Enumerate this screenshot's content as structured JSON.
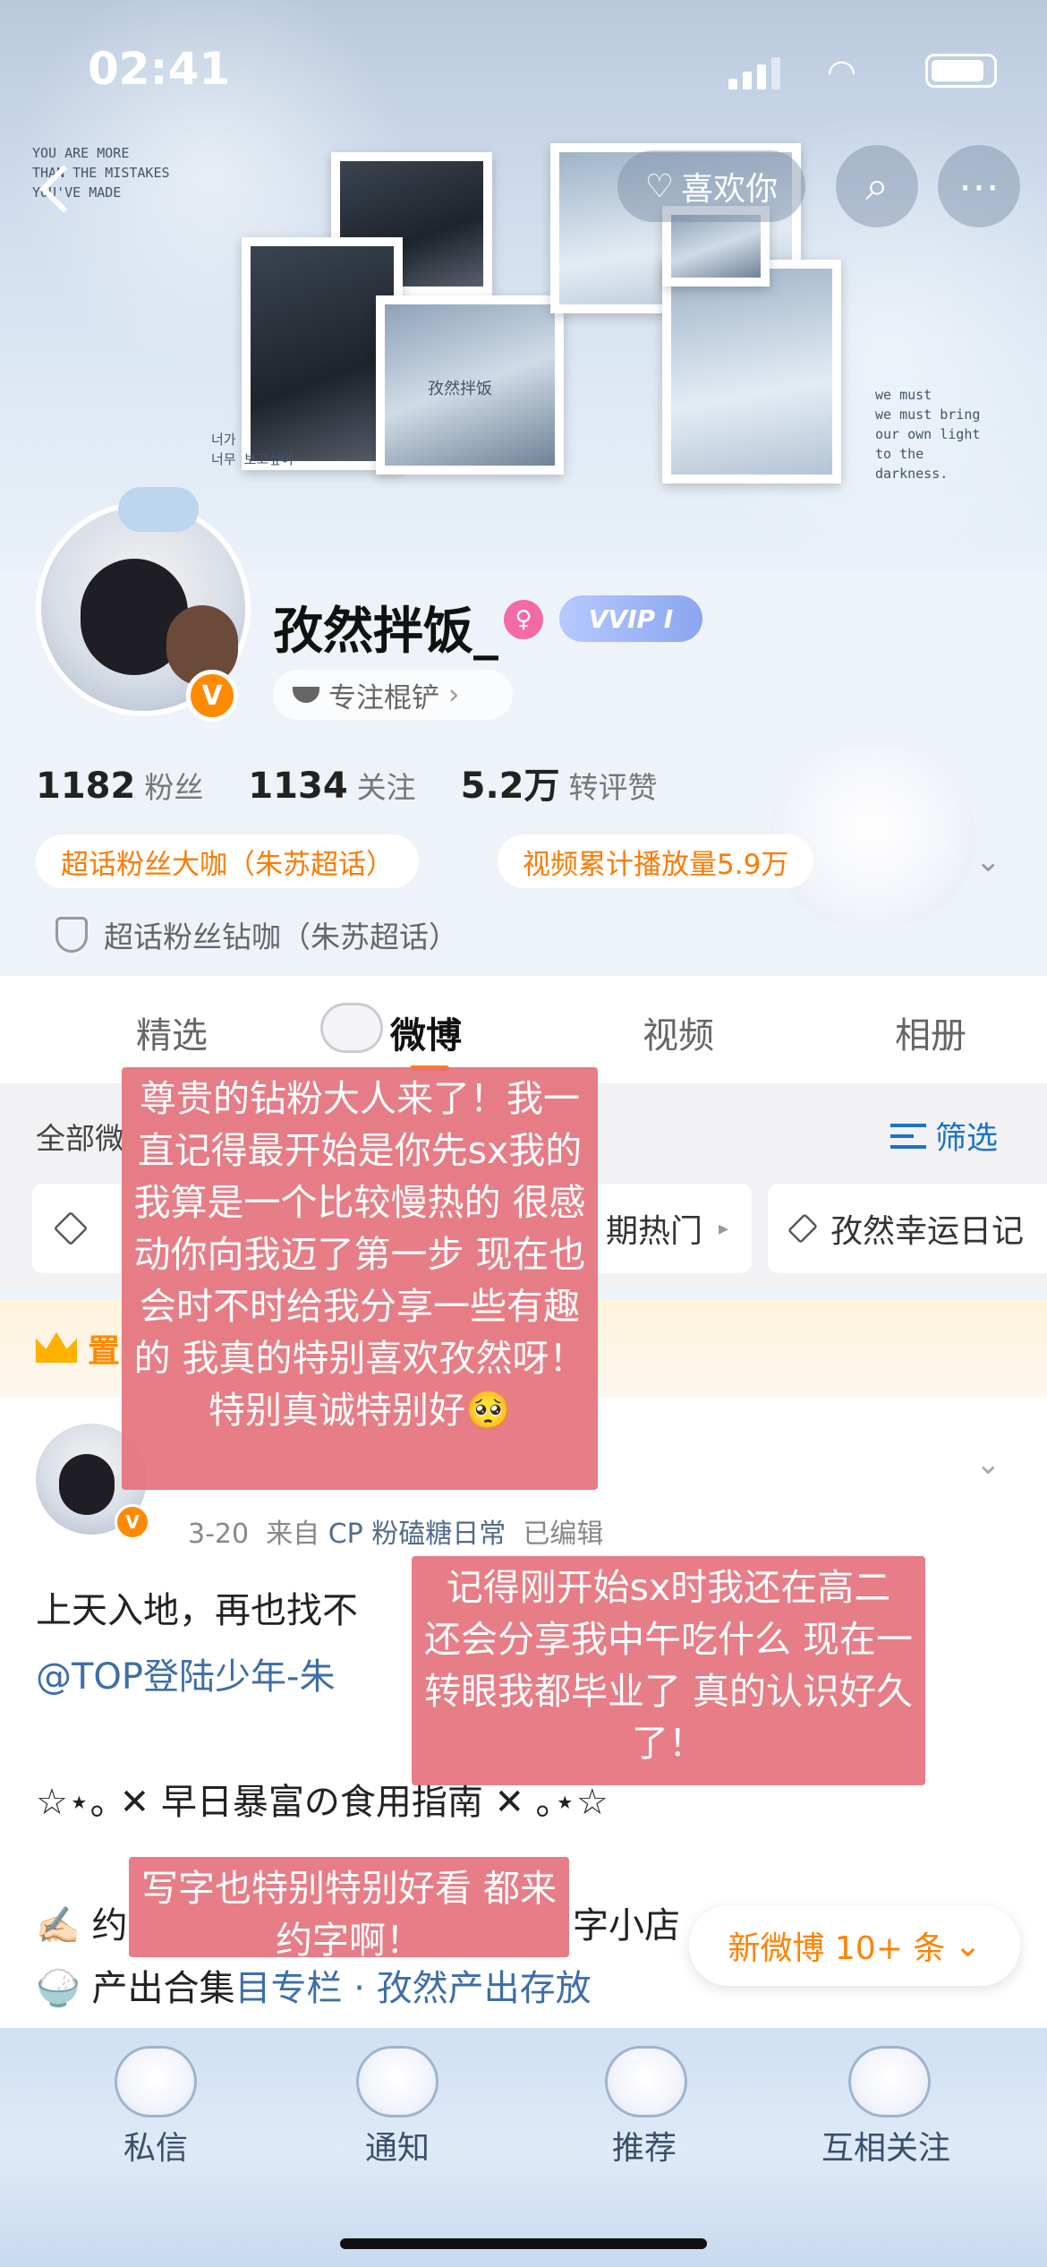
{
  "status_bar": {
    "time": "02:41"
  },
  "nav": {
    "like_label": "喜欢你"
  },
  "banner_text": {
    "left": [
      "YOU ARE MORE",
      "THAN THE MISTAKES",
      "YOU'VE MADE"
    ],
    "center": "孜然拌饭",
    "korean": [
      "너가",
      "너무 보고싶어"
    ],
    "right": [
      "we must",
      "we must bring",
      "our own light",
      "to the",
      "darkness."
    ]
  },
  "profile": {
    "username": "孜然拌饭_",
    "vip_label": "VVIP I",
    "verified_glyph": "V",
    "tag": "专注棍铲",
    "stats": [
      {
        "value": "1182",
        "label": "粉丝"
      },
      {
        "value": "1134",
        "label": "关注"
      },
      {
        "value": "5.2万",
        "label": "转评赞"
      }
    ],
    "badges": [
      "超话粉丝大咖（朱苏超话）",
      "视频累计播放量5.9万"
    ],
    "diamond_badge": "超话粉丝钻咖（朱苏超话）"
  },
  "tabs": [
    {
      "label": "精选",
      "active": false
    },
    {
      "label": "微博",
      "active": true
    },
    {
      "label": "视频",
      "active": false
    },
    {
      "label": "相册",
      "active": false
    }
  ],
  "filter": {
    "all_label": "全部微",
    "filter_label": "筛选",
    "chips": [
      "期热门",
      "孜然幸运日记"
    ]
  },
  "pinned": {
    "label": "置"
  },
  "post": {
    "meta_date": "3-20",
    "meta_from": "来自",
    "meta_source": "CP 粉磕糖日常",
    "meta_edited": "已编辑",
    "line1": "上天入地，再也找不",
    "line2_mention": "@TOP登陆少年-朱",
    "line3": "☆⋆｡ ✕ 早日暴富の食用指南 ✕ ｡⋆☆",
    "line4_start": "✍🏻 约",
    "line4_end": "字小店",
    "line5_start": "🍚 产出合集",
    "line5_link": "目专栏 · 孜然产出存放",
    "new_posts": "新微博 10+ 条"
  },
  "bottom_nav": [
    "私信",
    "通知",
    "推荐",
    "互相关注"
  ],
  "captions": {
    "c1": "尊贵的钻粉大人来了！我一直记得最开始是你先sx我的 我算是一个比较慢热的 很感动你向我迈了第一步 现在也会时不时给我分享一些有趣的 我真的特别喜欢孜然呀！特别真诚特别好🥺",
    "c2": "记得刚开始sx时我还在高二 还会分享我中午吃什么 现在一转眼我都毕业了 真的认识好久了！",
    "c3": "写字也特别特别好看 都来约字啊！"
  },
  "colors": {
    "accent_orange": "#ff8200",
    "link_blue": "#3e6ea8",
    "caption_pink": "#e5737d"
  }
}
